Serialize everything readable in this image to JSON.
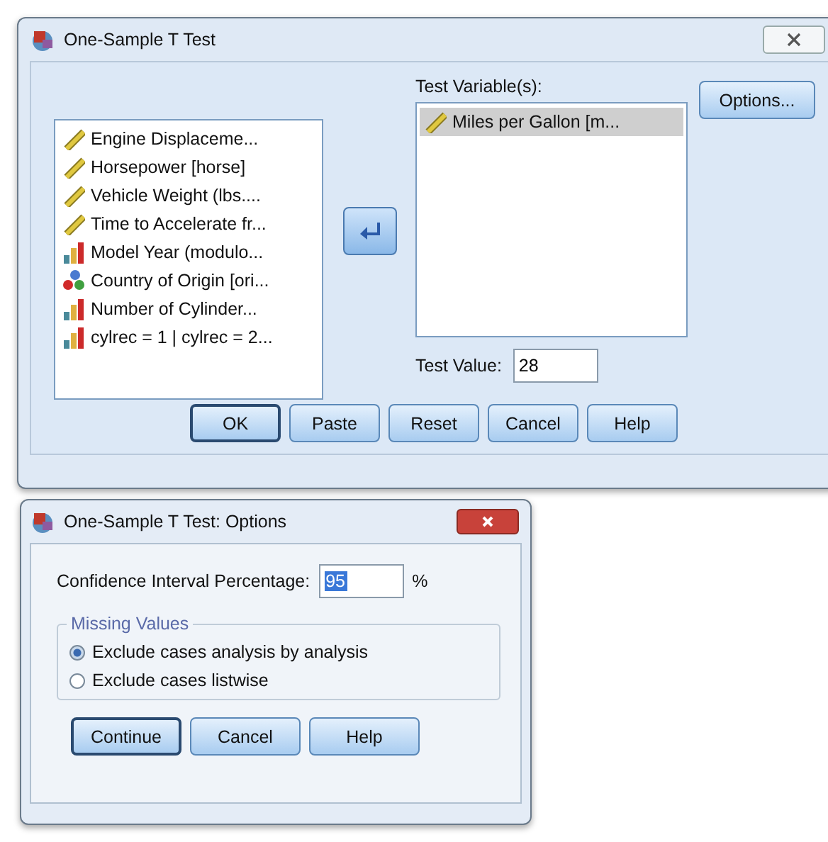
{
  "main_window": {
    "title": "One-Sample T Test",
    "source_variables": [
      {
        "label": "Engine Displaceme...",
        "kind": "scale",
        "selected": false
      },
      {
        "label": "Horsepower [horse]",
        "kind": "scale",
        "selected": false
      },
      {
        "label": "Vehicle Weight (lbs....",
        "kind": "scale",
        "selected": false
      },
      {
        "label": "Time to Accelerate fr...",
        "kind": "scale",
        "selected": false
      },
      {
        "label": "Model Year (modulo...",
        "kind": "ordinal",
        "selected": false
      },
      {
        "label": "Country of Origin [ori...",
        "kind": "nominal",
        "selected": false
      },
      {
        "label": "Number of Cylinder...",
        "kind": "ordinal",
        "selected": false
      },
      {
        "label": "cylrec = 1 | cylrec = 2...",
        "kind": "ordinal",
        "selected": false
      }
    ],
    "test_variables_label": "Test Variable(s):",
    "test_variables": [
      {
        "label": "Miles per Gallon [m...",
        "kind": "scale",
        "selected": true
      }
    ],
    "options_button": "Options...",
    "test_value_label": "Test Value:",
    "test_value": "28",
    "buttons": [
      {
        "label": "OK",
        "default": true
      },
      {
        "label": "Paste",
        "default": false
      },
      {
        "label": "Reset",
        "default": false
      },
      {
        "label": "Cancel",
        "default": false
      },
      {
        "label": "Help",
        "default": false
      }
    ]
  },
  "options_dialog": {
    "title": "One-Sample T Test: Options",
    "confidence_label": "Confidence Interval Percentage:",
    "confidence_value": "95",
    "percent_sign": "%",
    "missing_values_title": "Missing Values",
    "missing_values": [
      {
        "label": "Exclude cases analysis by analysis",
        "selected": true
      },
      {
        "label": "Exclude cases listwise",
        "selected": false
      }
    ],
    "buttons": [
      {
        "label": "Continue",
        "default": true
      },
      {
        "label": "Cancel",
        "default": false
      },
      {
        "label": "Help",
        "default": false
      }
    ]
  }
}
